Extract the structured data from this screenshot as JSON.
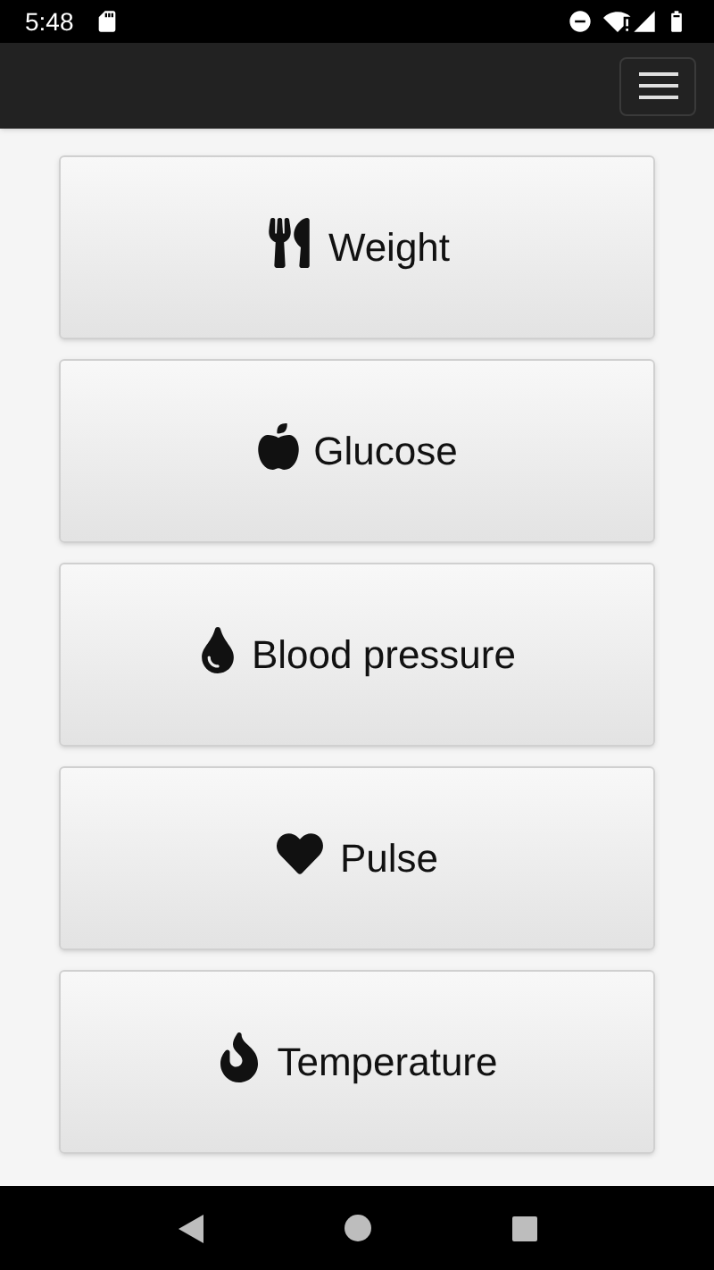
{
  "status_bar": {
    "time": "5:48"
  },
  "buttons": [
    {
      "label": "Weight",
      "kind": "utensils"
    },
    {
      "label": "Glucose",
      "kind": "apple"
    },
    {
      "label": "Blood pressure",
      "kind": "drop"
    },
    {
      "label": "Pulse",
      "kind": "heart"
    },
    {
      "label": "Temperature",
      "kind": "fire"
    }
  ]
}
